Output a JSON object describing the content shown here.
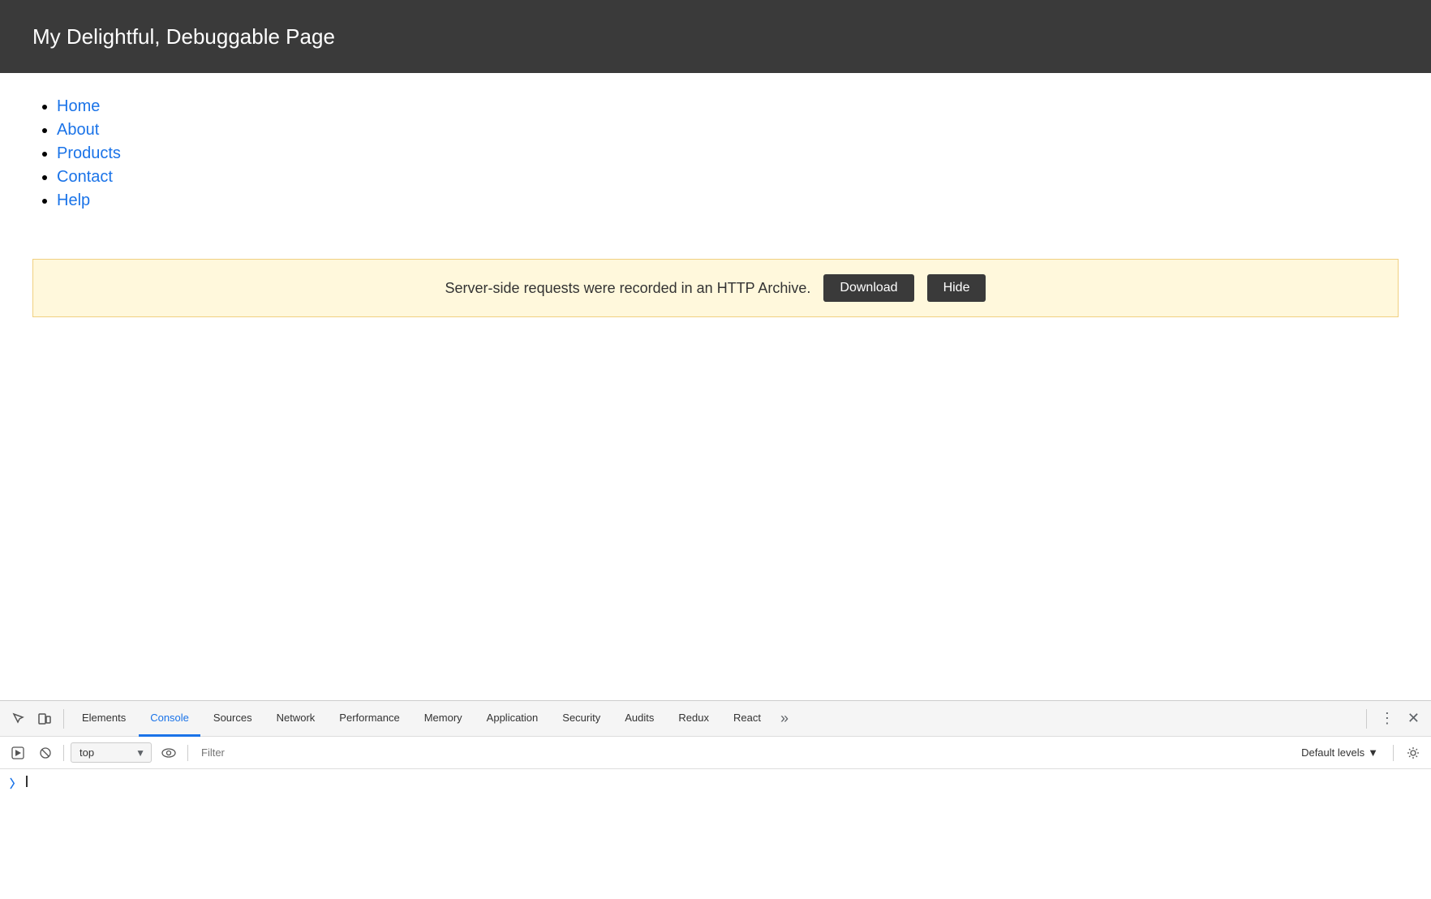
{
  "page": {
    "title": "My Delightful, Debuggable Page"
  },
  "nav": {
    "items": [
      {
        "label": "Home",
        "href": "#"
      },
      {
        "label": "About",
        "href": "#"
      },
      {
        "label": "Products",
        "href": "#"
      },
      {
        "label": "Contact",
        "href": "#"
      },
      {
        "label": "Help",
        "href": "#"
      }
    ]
  },
  "banner": {
    "text": "Server-side requests were recorded in an HTTP Archive.",
    "download_label": "Download",
    "hide_label": "Hide"
  },
  "devtools": {
    "tabs": [
      {
        "label": "Elements",
        "active": false
      },
      {
        "label": "Console",
        "active": true
      },
      {
        "label": "Sources",
        "active": false
      },
      {
        "label": "Network",
        "active": false
      },
      {
        "label": "Performance",
        "active": false
      },
      {
        "label": "Memory",
        "active": false
      },
      {
        "label": "Application",
        "active": false
      },
      {
        "label": "Security",
        "active": false
      },
      {
        "label": "Audits",
        "active": false
      },
      {
        "label": "Redux",
        "active": false
      },
      {
        "label": "React",
        "active": false
      }
    ],
    "console_bar": {
      "context": "top",
      "filter_placeholder": "Filter",
      "default_levels": "Default levels"
    }
  }
}
